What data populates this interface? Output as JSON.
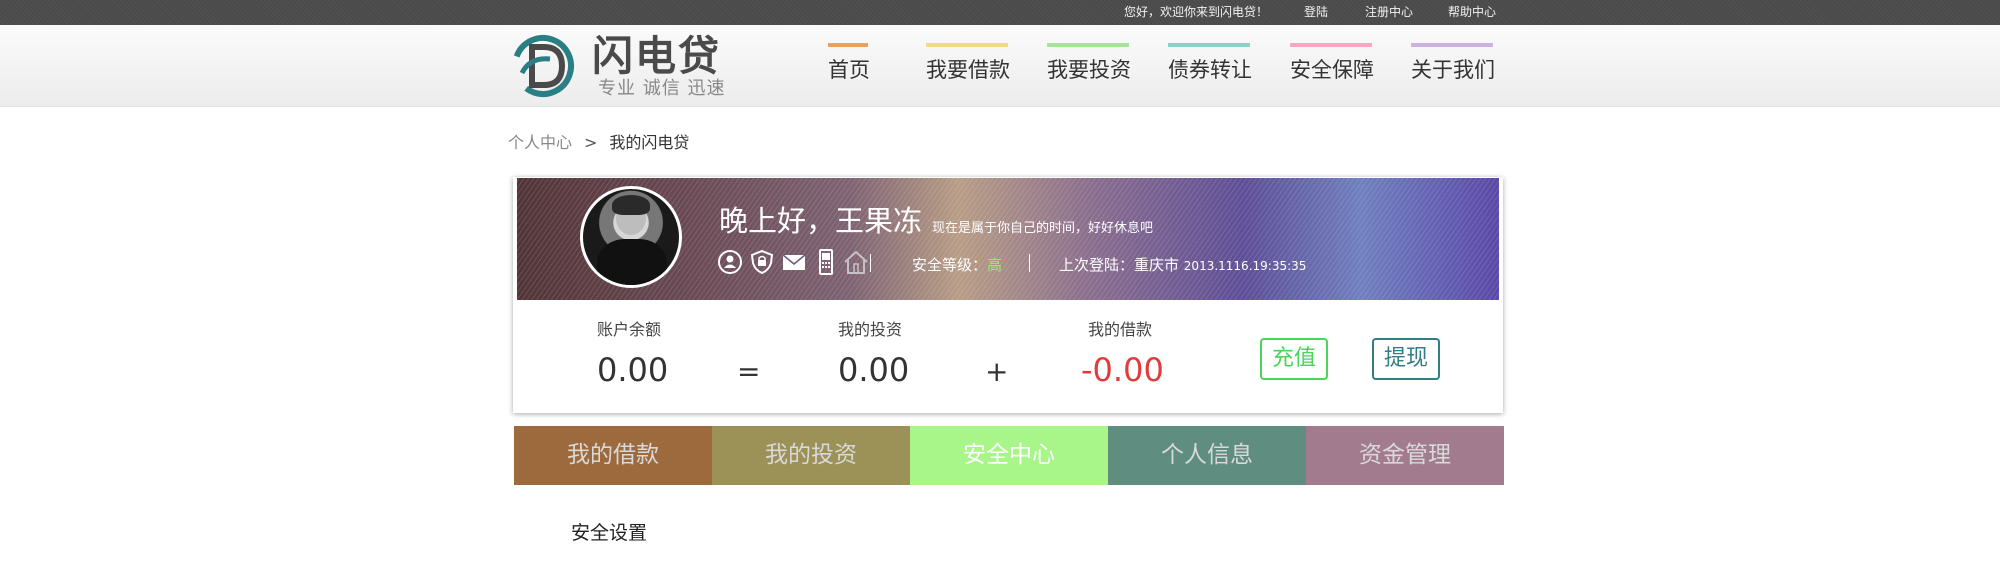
{
  "topbar": {
    "welcome": "您好，欢迎你来到闪电贷！",
    "login": "登陆",
    "register": "注册中心",
    "help": "帮助中心"
  },
  "logo": {
    "name": "闪电贷",
    "slogan": "专业 诚信 迅速",
    "accent": "#2a7f84"
  },
  "nav": [
    {
      "label": "首页",
      "color": "#e8a25f"
    },
    {
      "label": "我要借款",
      "color": "#f2d98a"
    },
    {
      "label": "我要投资",
      "color": "#a8e39c"
    },
    {
      "label": "债券转让",
      "color": "#8fd0c6"
    },
    {
      "label": "安全保障",
      "color": "#f3a9c2"
    },
    {
      "label": "关于我们",
      "color": "#c8b3e3"
    }
  ],
  "breadcrumb": {
    "home": "个人中心",
    "sep": ">",
    "current": "我的闪电贷"
  },
  "profile": {
    "greeting": "晚上好，王果冻",
    "subtitle": "现在是属于你自己的时间，好好休息吧",
    "icons": [
      "user-icon",
      "shield-icon",
      "mail-icon",
      "phone-icon",
      "home-icon"
    ],
    "security_label": "安全等级：",
    "security_level": "高",
    "last_login_label": "上次登陆：重庆市",
    "last_login_time": "2013.1116.19:35:35"
  },
  "stats": {
    "balance_label": "账户余额",
    "balance": "0.00",
    "equals": "=",
    "invest_label": "我的投资",
    "invest": "0.00",
    "plus": "+",
    "loan_label": "我的借款",
    "loan": "-0.00",
    "recharge": "充值",
    "withdraw": "提现"
  },
  "tabs": [
    {
      "label": "我的借款",
      "color": "#9c6a3c"
    },
    {
      "label": "我的投资",
      "color": "#9c9157"
    },
    {
      "label": "安全中心",
      "color": "#a8f68a"
    },
    {
      "label": "个人信息",
      "color": "#5f8e80"
    },
    {
      "label": "资金管理",
      "color": "#a37b8f"
    }
  ],
  "section": {
    "title": "安全设置"
  }
}
